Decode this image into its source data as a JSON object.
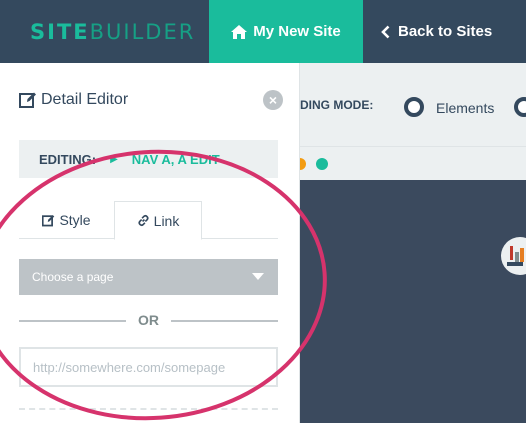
{
  "header": {
    "logo_part1": "SITE",
    "logo_part2": "BUILDER",
    "current_site_label": "My New Site",
    "back_label": "Back to Sites"
  },
  "modebar": {
    "label_fragment": "DING MODE:",
    "option_label": "Elements"
  },
  "panel": {
    "title": "Detail Editor",
    "editing_label": "EDITING:",
    "editing_value": "NAV A, A EDIT",
    "tabs": [
      {
        "label": "Style",
        "icon": "edit-icon",
        "active": false
      },
      {
        "label": "Link",
        "icon": "link-icon",
        "active": true
      }
    ],
    "select_value": "Choose a page",
    "or_text": "OR",
    "url_placeholder": "http://somewhere.com/somepage"
  },
  "colors": {
    "accent": "#1abc9c",
    "header_bg": "#34495e",
    "highlight": "#d6336c",
    "dot_orange": "#f39c12",
    "dot_green": "#1abc9c"
  }
}
